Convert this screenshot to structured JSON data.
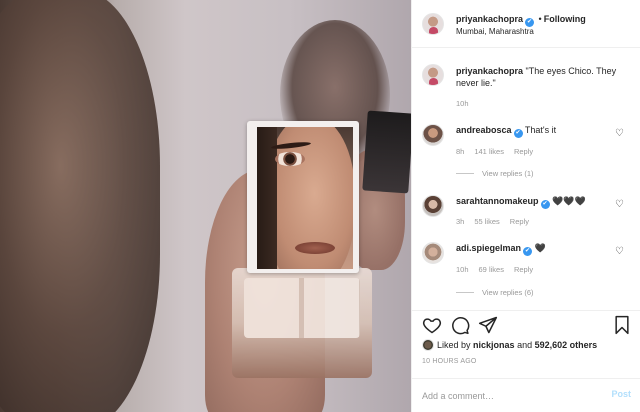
{
  "header": {
    "username": "priyankachopra",
    "separator": "•",
    "follow_status": "Following",
    "location": "Mumbai, Maharashtra",
    "verified_icon": "✔"
  },
  "caption": {
    "username": "priyankachopra",
    "text": "\"The eyes Chico. They never lie.\"",
    "time": "10h"
  },
  "comments": [
    {
      "username": "andreabosca",
      "verified": true,
      "text": "That's it",
      "time": "8h",
      "likes": "141 likes",
      "reply": "Reply",
      "view_replies": "View replies (1)"
    },
    {
      "username": "sarahtannomakeup",
      "verified": true,
      "text": "🖤🖤🖤",
      "time": "3h",
      "likes": "55 likes",
      "reply": "Reply"
    },
    {
      "username": "adi.spiegelman",
      "verified": true,
      "text": "🖤",
      "time": "10h",
      "likes": "69 likes",
      "reply": "Reply",
      "view_replies": "View replies (6)"
    }
  ],
  "actions": {
    "like_icon": "heart-outline-icon",
    "comment_icon": "comment-bubble-icon",
    "share_icon": "paper-plane-icon",
    "save_icon": "bookmark-icon"
  },
  "likes": {
    "prefix": "Liked by",
    "user": "nickjonas",
    "conj": "and",
    "count": "592,602 others"
  },
  "timestamp": "10 HOURS AGO",
  "add_comment": {
    "placeholder": "Add a comment…",
    "post_label": "Post"
  },
  "colors": {
    "verified": "#3897f0",
    "muted": "#999999",
    "post_disabled": "#b2dffc"
  }
}
